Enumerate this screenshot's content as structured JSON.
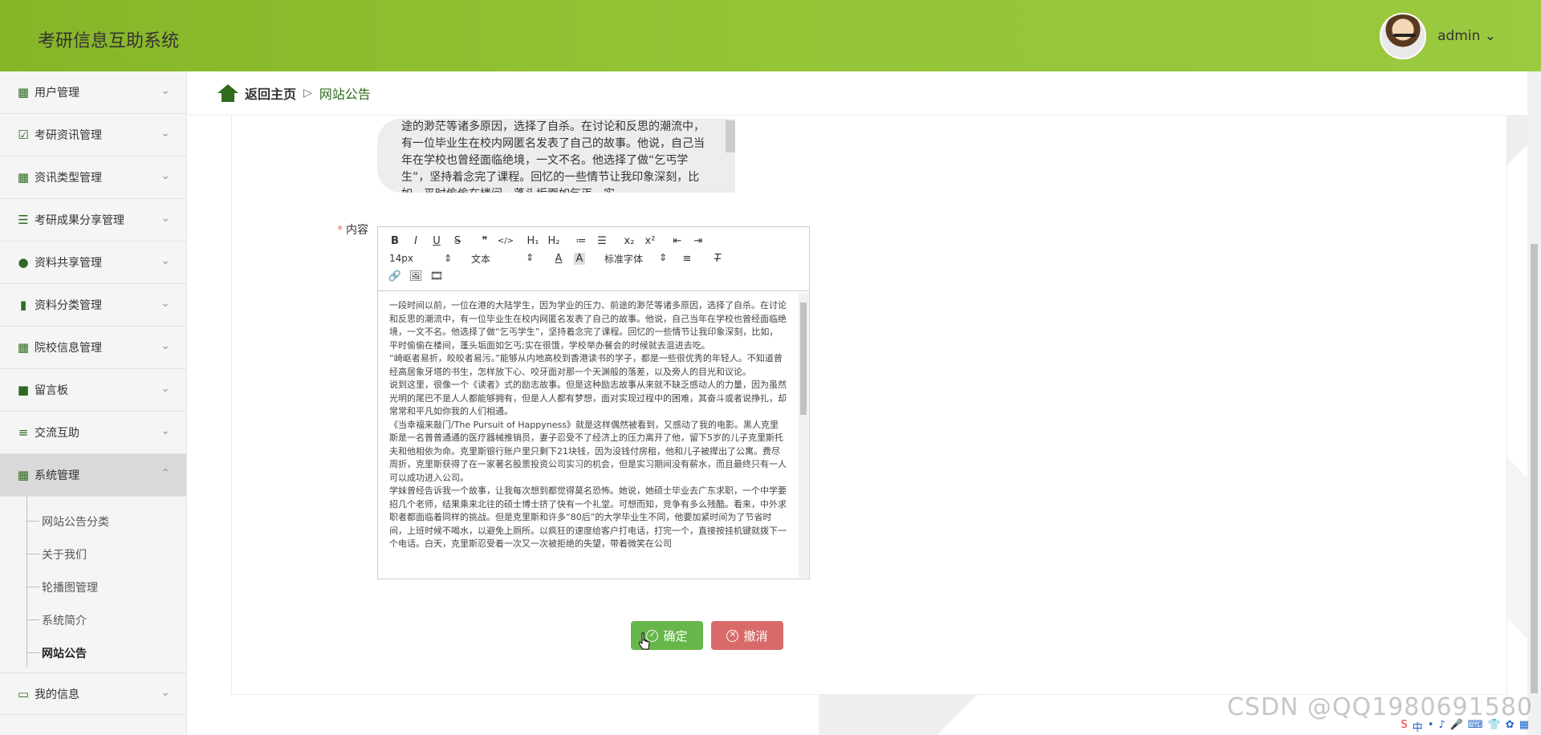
{
  "app": {
    "title": "考研信息互助系统"
  },
  "user": {
    "name": "admin ⌄"
  },
  "sidebar": {
    "items": [
      {
        "label": "用户管理",
        "icon": "grid-icon"
      },
      {
        "label": "考研资讯管理",
        "icon": "clipboard-check-icon"
      },
      {
        "label": "资讯类型管理",
        "icon": "grid-icon"
      },
      {
        "label": "考研成果分享管理",
        "icon": "list-icon"
      },
      {
        "label": "资料共享管理",
        "icon": "user-icon"
      },
      {
        "label": "资料分类管理",
        "icon": "bar-chart-icon"
      },
      {
        "label": "院校信息管理",
        "icon": "grid-icon"
      },
      {
        "label": "留言板",
        "icon": "briefcase-icon"
      },
      {
        "label": "交流互助",
        "icon": "sliders-icon"
      },
      {
        "label": "系统管理",
        "icon": "grid-icon"
      }
    ],
    "submenu": [
      "网站公告分类",
      "关于我们",
      "轮播图管理",
      "系统简介",
      "网站公告"
    ],
    "last_item": {
      "label": "我的信息",
      "icon": "card-icon"
    }
  },
  "breadcrumb": {
    "home": "返回主页",
    "separator": "▷",
    "current": "网站公告"
  },
  "form": {
    "summary_text": "途的渺茫等诸多原因，选择了自杀。在讨论和反思的潮流中，有一位毕业生在校内网匿名发表了自己的故事。他说，自己当年在学校也曾经面临绝境，一文不名。他选择了做“乞丐学生”，坚持着念完了课程。回忆的一些情节让我印象深刻，比如，平时偷偷在楼间，蓬头垢面如乞丐，实",
    "content_label": "内容",
    "required_mark": "*",
    "toolbar": {
      "row1": [
        "B",
        "I",
        "U",
        "S",
        "❞",
        "</>",
        "H₁",
        "H₂",
        "≔",
        "☰",
        "x₂",
        "x²",
        "⇤",
        "⇥"
      ],
      "font_size": "14px",
      "text_style": "文本",
      "font_family": "标准字体",
      "row3": [
        "🔗",
        "🖼",
        "🎞"
      ]
    },
    "content_paragraphs": [
      "一段时间以前，一位在港的大陆学生，因为学业的压力、前途的渺茫等诸多原因，选择了自杀。在讨论和反思的潮流中，有一位毕业生在校内网匿名发表了自己的故事。他说，自己当年在学校也曾经面临绝境，一文不名。他选择了做“乞丐学生”，坚持着念完了课程。回忆的一些情节让我印象深刻，比如，平时偷偷在楼间，蓬头垢面如乞丐;实在很饿，学校举办餐会的时候就去混进去吃。",
      "“崎岖者易折，皎皎者易污。”能够从内地高校到香港读书的学子，都是一些很优秀的年轻人。不知道曾经高居象牙塔的书生，怎样放下心、咬牙面对那一个天渊般的落差，以及旁人的目光和议论。",
      "说到这里，很像一个《读者》式的励志故事。但是这种励志故事从来就不缺乏感动人的力量，因为虽然光明的尾巴不是人人都能够拥有，但是人人都有梦想，面对实现过程中的困难，其奋斗或者说挣扎，却常常和平凡如你我的人们相通。",
      "《当幸福来敲门/The Pursuit of Happyness》就是这样偶然被看到，又感动了我的电影。黑人克里斯是一名普普通通的医疗器械推销员，妻子忍受不了经济上的压力离开了他，留下5岁的儿子克里斯托夫和他相依为命。克里斯银行账户里只剩下21块钱，因为没钱付房租，他和儿子被撵出了公寓。费尽周折，克里斯获得了在一家著名股票投资公司实习的机会，但是实习期间没有薪水，而且最终只有一人可以成功进入公司。",
      "学妹曾经告诉我一个故事，让我每次想到都觉得莫名恐怖。她说，她硕士毕业去广东求职，一个中学要招几个老师，结果乘来北往的硕士博士挤了快有一个礼堂。可想而知，竞争有多么残酷。看来，中外求职者都面临着同样的挑战。但是克里斯和许多“80后”的大学毕业生不同，他要加紧时间为了节省时间，上班时候不喝水，以避免上厕所。以疯狂的速度给客户打电话，打完一个，直接按挂机键就拨下一个电话。白天，克里斯忍受着一次又一次被拒绝的失望，带着微笑在公司"
    ],
    "confirm_label": "确定",
    "cancel_label": "撤消"
  },
  "watermark": "CSDN @QQ1980691580",
  "tray": [
    "S",
    "中",
    "•",
    "♪",
    "🎤",
    "⌨",
    "👕",
    "✿",
    "▦"
  ]
}
